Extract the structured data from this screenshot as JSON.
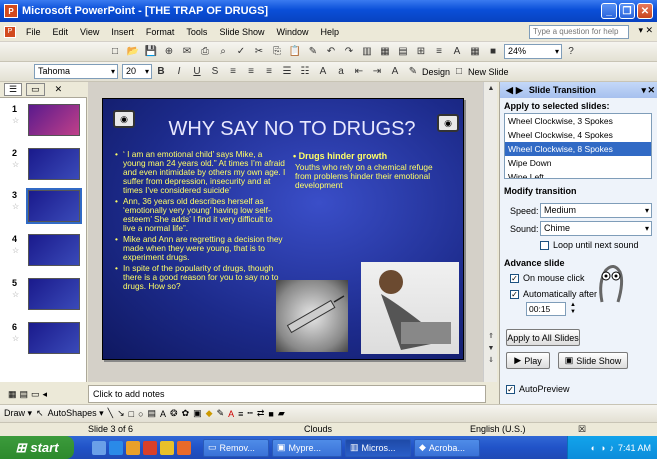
{
  "window": {
    "title": "Microsoft PowerPoint - [THE TRAP OF DRUGS]"
  },
  "menu": [
    "File",
    "Edit",
    "View",
    "Insert",
    "Format",
    "Tools",
    "Slide Show",
    "Window",
    "Help"
  ],
  "help_placeholder": "Type a question for help",
  "standard_toolbar": {
    "zoom": "24%"
  },
  "format_toolbar": {
    "font": "Tahoma",
    "size": "20",
    "design_label": "Design",
    "new_slide_label": "New Slide"
  },
  "slides_pane": {
    "thumbnails": [
      {
        "num": "1"
      },
      {
        "num": "2"
      },
      {
        "num": "3"
      },
      {
        "num": "4"
      },
      {
        "num": "5"
      },
      {
        "num": "6"
      }
    ],
    "selected": 3
  },
  "slide": {
    "title": "WHY SAY NO TO DRUGS?",
    "bullets": [
      "‘ I am an emotional child’ says Mike, a young man 24 years old.” At times I’m afraid and even intimidate by others my own age. I suffer from depression, insecurity and at times I’ve considered suicide’",
      "Ann, 36 years old describes herself as ‘emotionally very young’ having low self-esteem’ She adds’ I find it very difficult to live a normal life”.",
      "Mike and Ann are regretting a decision they made when they were young, that is to experiment drugs.",
      "In spite of the popularity of drugs, though there is a good reason for you to say no to drugs. How so?"
    ],
    "side_heading": "Drugs hinder growth",
    "side_text": "Youths who rely on a chemical refuge from problems hinder their emotional development"
  },
  "notes_placeholder": "Click to add notes",
  "task_pane": {
    "title": "Slide Transition",
    "apply_heading": "Apply to selected slides:",
    "transitions": [
      "Wheel Clockwise, 3 Spokes",
      "Wheel Clockwise, 4 Spokes",
      "Wheel Clockwise, 8 Spokes",
      "Wipe Down",
      "Wipe Left"
    ],
    "selected_transition": "Wheel Clockwise, 8 Spokes",
    "modify_heading": "Modify transition",
    "speed_label": "Speed:",
    "speed_value": "Medium",
    "sound_label": "Sound:",
    "sound_value": "Chime",
    "loop_label": "Loop until next sound",
    "advance_heading": "Advance slide",
    "on_click_label": "On mouse click",
    "auto_label": "Automatically after",
    "auto_value": "00:15",
    "apply_all_label": "Apply to All Slides",
    "play_label": "Play",
    "slideshow_label": "Slide Show",
    "autopreview_label": "AutoPreview"
  },
  "drawing_toolbar": {
    "draw_label": "Draw",
    "autoshapes_label": "AutoShapes"
  },
  "status": {
    "slide": "Slide 3 of 6",
    "design": "Clouds",
    "language": "English (U.S.)"
  },
  "taskbar": {
    "start_label": "start",
    "tasks": [
      "Remov...",
      "Mypre...",
      "Micros...",
      "Acroba..."
    ],
    "active_task": 2,
    "clock": "7:41 AM"
  }
}
